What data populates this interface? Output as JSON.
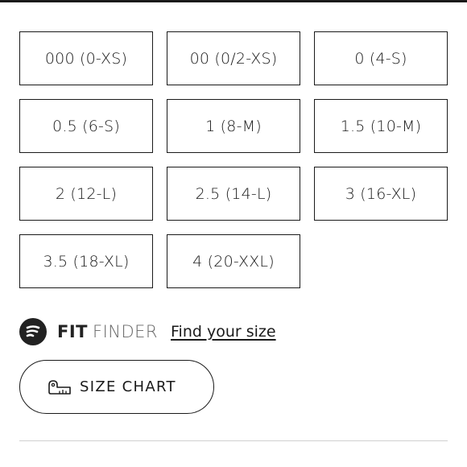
{
  "sizes": [
    {
      "label": "000 (0-XS)"
    },
    {
      "label": "00 (0/2-XS)"
    },
    {
      "label": "0 (4-S)"
    },
    {
      "label": "0.5 (6-S)"
    },
    {
      "label": "1 (8-M)"
    },
    {
      "label": "1.5 (10-M)"
    },
    {
      "label": "2 (12-L)"
    },
    {
      "label": "2.5 (14-L)"
    },
    {
      "label": "3 (16-XL)"
    },
    {
      "label": "3.5 (18-XL)"
    },
    {
      "label": "4 (20-XXL)"
    }
  ],
  "fit_finder": {
    "icon": "fit-finder-logo-icon",
    "brand_bold": "FIT",
    "brand_light": "FINDER",
    "link_text": "Find your size"
  },
  "size_chart": {
    "icon": "ruler-icon",
    "label": "SIZE CHART"
  },
  "colors": {
    "border": "#1a1a1a",
    "text": "#1a1a1a",
    "muted": "#666666",
    "divider": "#d0d0d0",
    "logo_bg": "#222222"
  }
}
